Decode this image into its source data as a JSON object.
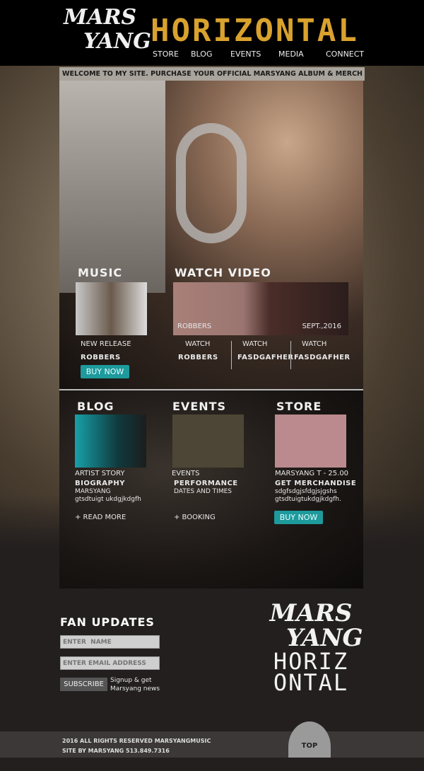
{
  "header": {
    "logo_line1": "MARS",
    "logo_line2": "YANG",
    "title": "HORIZONTAL",
    "nav": [
      "STORE",
      "BLOG",
      "EVENTS",
      "MEDIA",
      "CONNECT"
    ]
  },
  "welcome": "WELCOME TO MY SITE.  PURCHASE YOUR OFFICIAL MARSYANG ALBUM & MERCH HERE.",
  "music": {
    "heading": "MUSIC",
    "release_label": "NEW RELEASE",
    "release_title": "ROBBERS",
    "buy": "BUY NOW"
  },
  "video": {
    "heading": "WATCH VIDEO",
    "video_title": "ROBBERS",
    "video_date": "SEPT.,2016",
    "items": [
      {
        "label": "WATCH",
        "title": "ROBBERS"
      },
      {
        "label": "WATCH",
        "title": "FASDGAFHER"
      },
      {
        "label": "WATCH",
        "title": "FASDGAFHER"
      }
    ]
  },
  "blog": {
    "heading": "BLOG",
    "category": "ARTIST STORY",
    "title": "BIOGRAPHY",
    "line1": "MARSYANG",
    "line2": "gtsdtuigt ukdgjkdgfh",
    "link": "+ READ MORE"
  },
  "events": {
    "heading": "EVENTS",
    "category": "EVENTS",
    "title": "PERFORMANCE",
    "line1": "DATES AND TIMES",
    "link": "+ BOOKING"
  },
  "store": {
    "heading": "STORE",
    "category": "MARSYANG T - 25.00",
    "title": "GET MERCHANDISE",
    "line1": "sdgfsdgjsfdgjsjgshs",
    "line2": "gtsdtuigtukdgjkdgfh.",
    "buy": "BUY NOW"
  },
  "fan": {
    "heading": "FAN UPDATES",
    "name_placeholder": "ENTER  NAME",
    "email_placeholder": "ENTER EMAIL ADDRESS",
    "subscribe": "SUBSCRIBE",
    "note1": "Signup & get",
    "note2": "Marsyang news"
  },
  "biglogo": {
    "l1": "MARS",
    "l2": "YANG",
    "l3": "HORIZ",
    "l4": "ONTAL"
  },
  "footer": {
    "line1": "2016 ALL RIGHTS RESERVED MARSYANGMUSIC",
    "line2": "SITE BY MARSYANG 513.849.7316",
    "top": "TOP"
  }
}
